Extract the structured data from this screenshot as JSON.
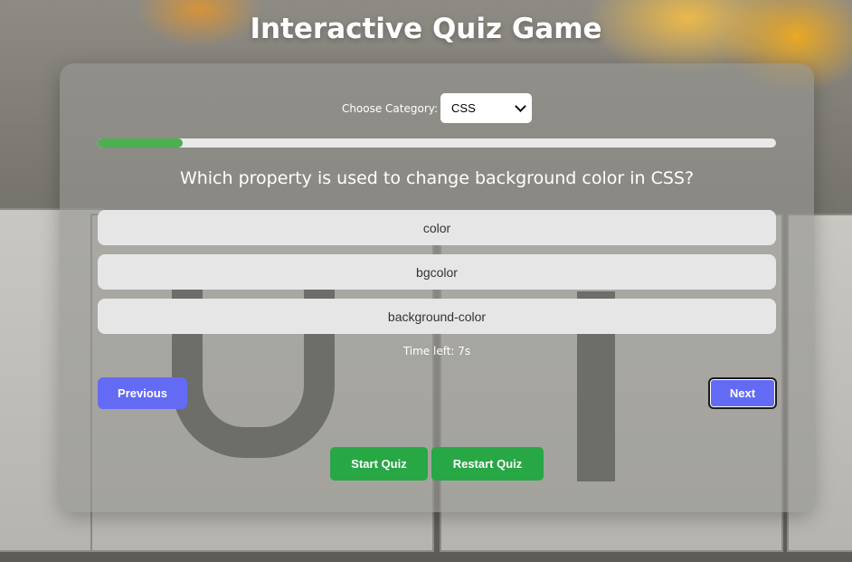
{
  "page": {
    "title": "Interactive Quiz Game"
  },
  "category": {
    "label": "Choose Category:",
    "selected": "CSS"
  },
  "progress": {
    "fraction": 0.125
  },
  "question": {
    "text": "Which property is used to change background color in CSS?"
  },
  "options": [
    {
      "label": "color"
    },
    {
      "label": "bgcolor"
    },
    {
      "label": "background-color"
    }
  ],
  "timer": {
    "text": "Time left: 7s"
  },
  "navigation": {
    "previous_label": "Previous",
    "next_label": "Next"
  },
  "actions": {
    "start_label": "Start Quiz",
    "restart_label": "Restart Quiz"
  },
  "colors": {
    "progress_fill": "#4caf50",
    "nav_button": "#636bf5",
    "action_button": "#28a745",
    "option_background": "#e6e6e6"
  },
  "icons": {
    "select_arrow": "chevron-down-icon"
  }
}
